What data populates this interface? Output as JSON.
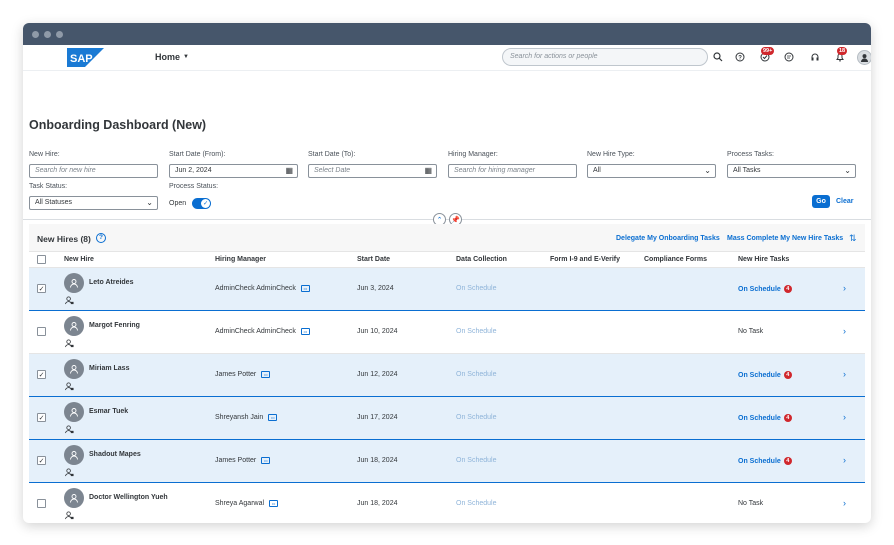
{
  "shell": {
    "home_label": "Home",
    "search_placeholder": "Search for actions or people",
    "notifications_badge": "99+",
    "bell_badge": "18",
    "brand_color": "#0a6ed1"
  },
  "page": {
    "title": "Onboarding Dashboard (New)"
  },
  "filters": {
    "new_hire": {
      "label": "New Hire:",
      "placeholder": "Search for new hire"
    },
    "start_from": {
      "label": "Start Date (From):",
      "value": "Jun 2, 2024"
    },
    "start_to": {
      "label": "Start Date (To):",
      "placeholder": "Select Date"
    },
    "hiring_manager": {
      "label": "Hiring Manager:",
      "placeholder": "Search for hiring manager"
    },
    "new_hire_type": {
      "label": "New Hire Type:",
      "value": "All"
    },
    "process_tasks": {
      "label": "Process Tasks:",
      "value": "All Tasks"
    },
    "task_status": {
      "label": "Task Status:",
      "value": "All Statuses"
    },
    "process_status": {
      "label": "Process Status:",
      "value": "Open"
    },
    "go_label": "Go",
    "clear_label": "Clear"
  },
  "table": {
    "title": "New Hires (8)",
    "delegate_label": "Delegate My Onboarding Tasks",
    "mass_complete_label": "Mass Complete My New Hire Tasks",
    "columns": [
      "New Hire",
      "Hiring Manager",
      "Start Date",
      "Data Collection",
      "Form I-9 and E-Verify",
      "Compliance Forms",
      "New Hire Tasks"
    ],
    "rows": [
      {
        "name": "Leto Atreides",
        "manager": "AdminCheck AdminCheck",
        "start": "Jun 3, 2024",
        "data_collection": "On Schedule",
        "tasks": "On Schedule",
        "badge": "4",
        "selected": true
      },
      {
        "name": "Margot Fenring",
        "manager": "AdminCheck AdminCheck",
        "start": "Jun 10, 2024",
        "data_collection": "On Schedule",
        "tasks": "No Task",
        "badge": "",
        "selected": false
      },
      {
        "name": "Miriam Lass",
        "manager": "James Potter",
        "start": "Jun 12, 2024",
        "data_collection": "On Schedule",
        "tasks": "On Schedule",
        "badge": "4",
        "selected": true
      },
      {
        "name": "Esmar Tuek",
        "manager": "Shreyansh Jain",
        "start": "Jun 17, 2024",
        "data_collection": "On Schedule",
        "tasks": "On Schedule",
        "badge": "4",
        "selected": true
      },
      {
        "name": "Shadout Mapes",
        "manager": "James Potter",
        "start": "Jun 18, 2024",
        "data_collection": "On Schedule",
        "tasks": "On Schedule",
        "badge": "4",
        "selected": true
      },
      {
        "name": "Doctor Wellington Yueh",
        "manager": "Shreya Agarwal",
        "start": "Jun 18, 2024",
        "data_collection": "On Schedule",
        "tasks": "No Task",
        "badge": "",
        "selected": false
      }
    ]
  }
}
